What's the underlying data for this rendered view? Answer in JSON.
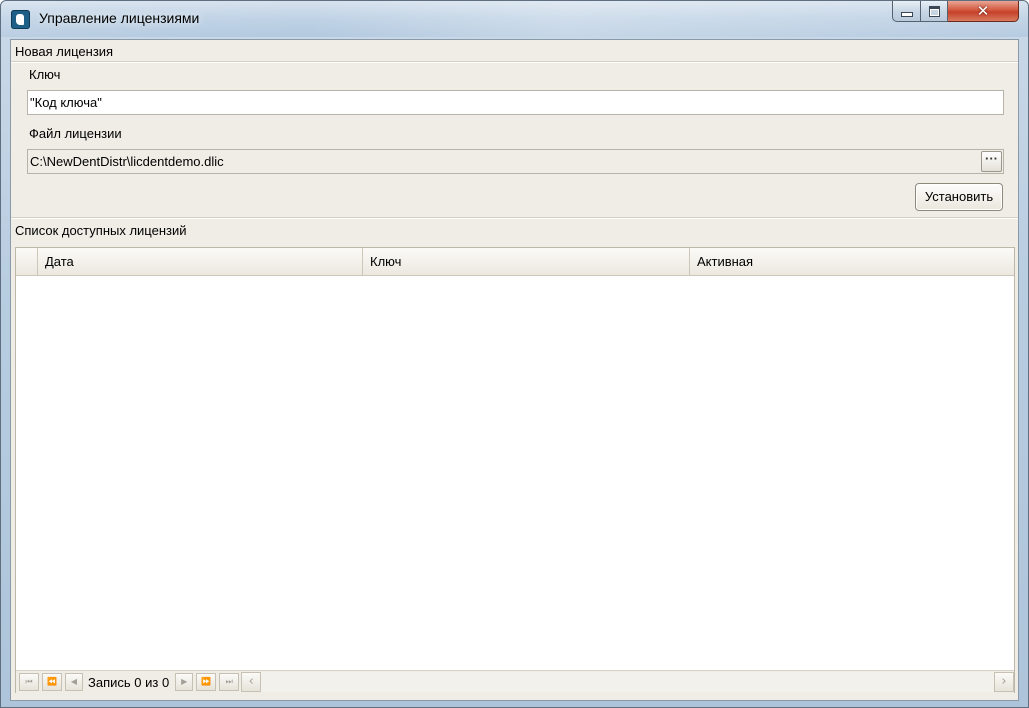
{
  "window": {
    "title": "Управление лицензиями"
  },
  "new_license": {
    "group_title": "Новая лицензия",
    "key_label": "Ключ",
    "key_value": "\"Код ключа\"",
    "file_label": "Файл лицензии",
    "file_value": "C:\\NewDentDistr\\licdentdemo.dlic",
    "browse_label": "···",
    "install_button": "Установить"
  },
  "licenses": {
    "group_title": "Список доступных лицензий",
    "columns": [
      "Дата",
      "Ключ",
      "Активная"
    ],
    "rows": []
  },
  "navigator": {
    "record_text": "Запись 0 из 0",
    "first": "⏮",
    "prev_page": "⏪",
    "prev": "◀",
    "next": "▶",
    "next_page": "⏩",
    "last": "⏭",
    "scroll_left": "‹",
    "scroll_right": "›"
  },
  "colors": {
    "client_bg": "#f0ede6",
    "close_button": "#c6402a",
    "icon_blue": "#1d5f86"
  }
}
